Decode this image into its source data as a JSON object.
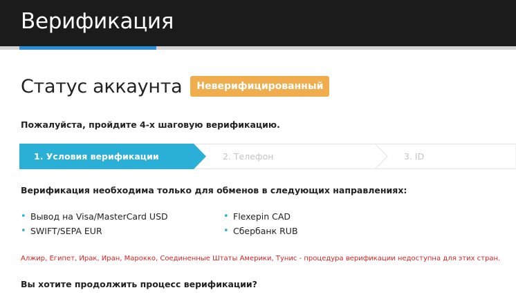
{
  "header": {
    "title": "Верификация"
  },
  "status": {
    "title": "Статус аккаунта",
    "badge": "Неверифицированный",
    "badge_color": "#f0ad4e"
  },
  "intro": "Пожалуйста, пройдите 4-х шаговую верификацию.",
  "steps": [
    {
      "label": "1. Условия верификации",
      "active": true
    },
    {
      "label": "2. Телефон",
      "active": false
    },
    {
      "label": "3. ID",
      "active": false
    }
  ],
  "requirements": {
    "title": "Верификация необходима только для обменов в следующих направлениях:",
    "left": [
      "Вывод на Visa/MasterCard USD",
      "SWIFT/SEPA EUR"
    ],
    "right": [
      "Flexepin CAD",
      "Сбербанк RUB"
    ]
  },
  "warning": "Алжир, Египет, Ирак, Иран, Марокко, Соединенные Штаты Америки, Тунис - процедура верификации недоступна для этих стран.",
  "question": "Вы хотите продолжить процесс верификации?",
  "colors": {
    "accent": "#2ab0d6",
    "tab_active": "#2a8fd4",
    "warning": "#e02020",
    "header_bg": "#1b1b1b"
  }
}
